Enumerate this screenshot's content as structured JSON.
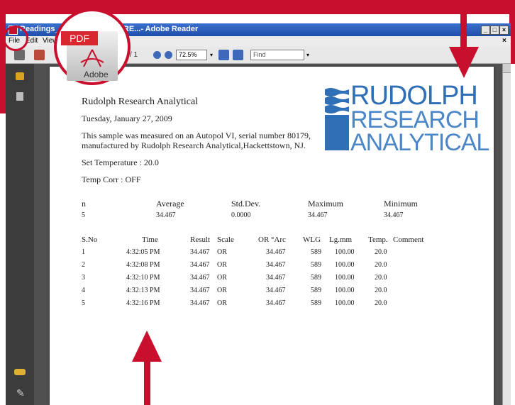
{
  "window": {
    "title": "Readings_20... - Adobe Reader",
    "title_visible": "Readings_20",
    "title_suffix": "CURE...- Adobe Reader"
  },
  "menu": {
    "file": "File",
    "edit": "Edit",
    "view": "View"
  },
  "toolbar": {
    "page_sep": "/ 1",
    "zoom": "72.5%",
    "find_placeholder": "Find"
  },
  "badge": {
    "pdf": "PDF",
    "adobe": "Adobe"
  },
  "document": {
    "company": "Rudolph Research Analytical",
    "date": "Tuesday, January 27, 2009",
    "desc_line1": "This sample was measured on an Autopol VI, serial number 80179,",
    "desc_line2": "manufactured by Rudolph Research Analytical,Hackettstown, NJ.",
    "set_temp": "Set Temperature : 20.0",
    "temp_corr": "Temp Corr : OFF",
    "summary": {
      "headers": [
        "n",
        "Average",
        "Std.Dev.",
        "Maximum",
        "Minimum"
      ],
      "values": [
        "5",
        "34.467",
        "0.0000",
        "34.467",
        "34.467"
      ]
    },
    "table": {
      "headers": [
        "S.No",
        "Time",
        "Result",
        "Scale",
        "OR °Arc",
        "WLG",
        "Lg.mm",
        "Temp.",
        "Comment"
      ],
      "rows": [
        [
          "1",
          "4:32:05 PM",
          "34.467",
          "OR",
          "34.467",
          "589",
          "100.00",
          "20.0",
          ""
        ],
        [
          "2",
          "4:32:08 PM",
          "34.467",
          "OR",
          "34.467",
          "589",
          "100.00",
          "20.0",
          ""
        ],
        [
          "3",
          "4:32:10 PM",
          "34.467",
          "OR",
          "34.467",
          "589",
          "100.00",
          "20.0",
          ""
        ],
        [
          "4",
          "4:32:13 PM",
          "34.467",
          "OR",
          "34.467",
          "589",
          "100.00",
          "20.0",
          ""
        ],
        [
          "5",
          "4:32:16 PM",
          "34.467",
          "OR",
          "34.467",
          "589",
          "100.00",
          "20.0",
          ""
        ]
      ]
    }
  },
  "logo": {
    "line1": "RUDOLPH",
    "line2": "RESEARCH",
    "line3": "ANALYTICAL"
  },
  "colors": {
    "accent_red": "#c8102e",
    "logo_blue": "#2e6fb5",
    "title_blue": "#1f4fa8"
  }
}
